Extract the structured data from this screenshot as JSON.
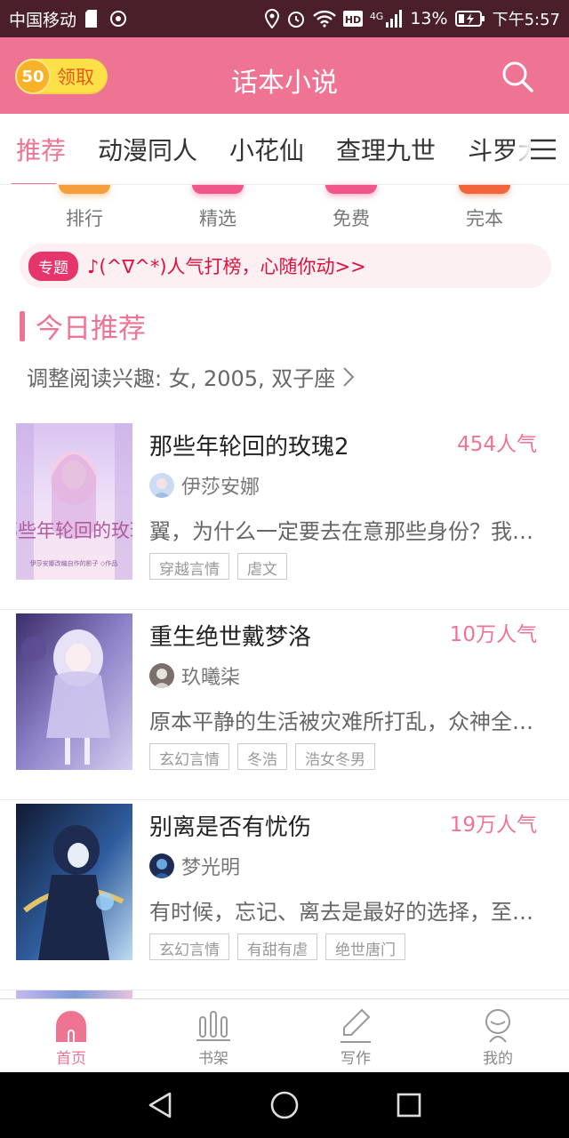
{
  "statusbar": {
    "carrier": "中国移动",
    "network": "4G",
    "battery": "13%",
    "time": "下午5:57"
  },
  "header": {
    "coin_amount": "50",
    "claim_label": "领取",
    "title": "话本小说"
  },
  "tabs": [
    {
      "label": "推荐",
      "active": true
    },
    {
      "label": "动漫同人",
      "active": false
    },
    {
      "label": "小花仙",
      "active": false
    },
    {
      "label": "查理九世",
      "active": false
    },
    {
      "label": "斗罗大陆",
      "active": false
    }
  ],
  "quick_nav": [
    {
      "label": "排行",
      "color": "#f59e3b"
    },
    {
      "label": "精选",
      "color": "#f0568a"
    },
    {
      "label": "免费",
      "color": "#f0568a"
    },
    {
      "label": "完本",
      "color": "#f2643a"
    }
  ],
  "banner": {
    "badge": "专题",
    "text": "♪(^∇^*)人气打榜，心随你动>>"
  },
  "section": {
    "title": "今日推荐",
    "interest": "调整阅读兴趣: 女, 2005, 双子座"
  },
  "books": [
    {
      "title": "那些年轮回的玫瑰2",
      "popularity": "454人气",
      "author": "伊莎安娜",
      "summary": "翼，为什么一定要去在意那些身份？我喜欢的",
      "tags": [
        "穿越言情",
        "虐文"
      ],
      "cover_colors": [
        "#e9d8f4",
        "#c9a6e6",
        "#f5d6ea"
      ],
      "cover_text": "那些年轮回的玫瑰",
      "cover_subtext": "伊莎安娜改编自作的影子 ◇作品"
    },
    {
      "title": "重生绝世戴梦洛",
      "popularity": "10万人气",
      "author": "玖曦柒",
      "summary": "原本平静的生活被灾难所打乱，众神全部陨落",
      "tags": [
        "玄幻言情",
        "冬浩",
        "浩女冬男"
      ],
      "cover_colors": [
        "#4b3a78",
        "#9c8fd1",
        "#e3dcf5"
      ]
    },
    {
      "title": "别离是否有忧伤",
      "popularity": "19万人气",
      "author": "梦光明",
      "summary": "有时候，忘记、离去是最好的选择，至少能够",
      "tags": [
        "玄幻言情",
        "有甜有虐",
        "绝世唐门"
      ],
      "cover_colors": [
        "#16213e",
        "#3f6fb5",
        "#b9d7f2"
      ]
    }
  ],
  "bottom_nav": [
    {
      "label": "首页",
      "active": true
    },
    {
      "label": "书架",
      "active": false
    },
    {
      "label": "写作",
      "active": false
    },
    {
      "label": "我的",
      "active": false
    }
  ],
  "colors": {
    "accent": "#ef7493",
    "statusbar": "#4a1f2a",
    "coin": "#fde047",
    "banner_text": "#e0103d"
  }
}
